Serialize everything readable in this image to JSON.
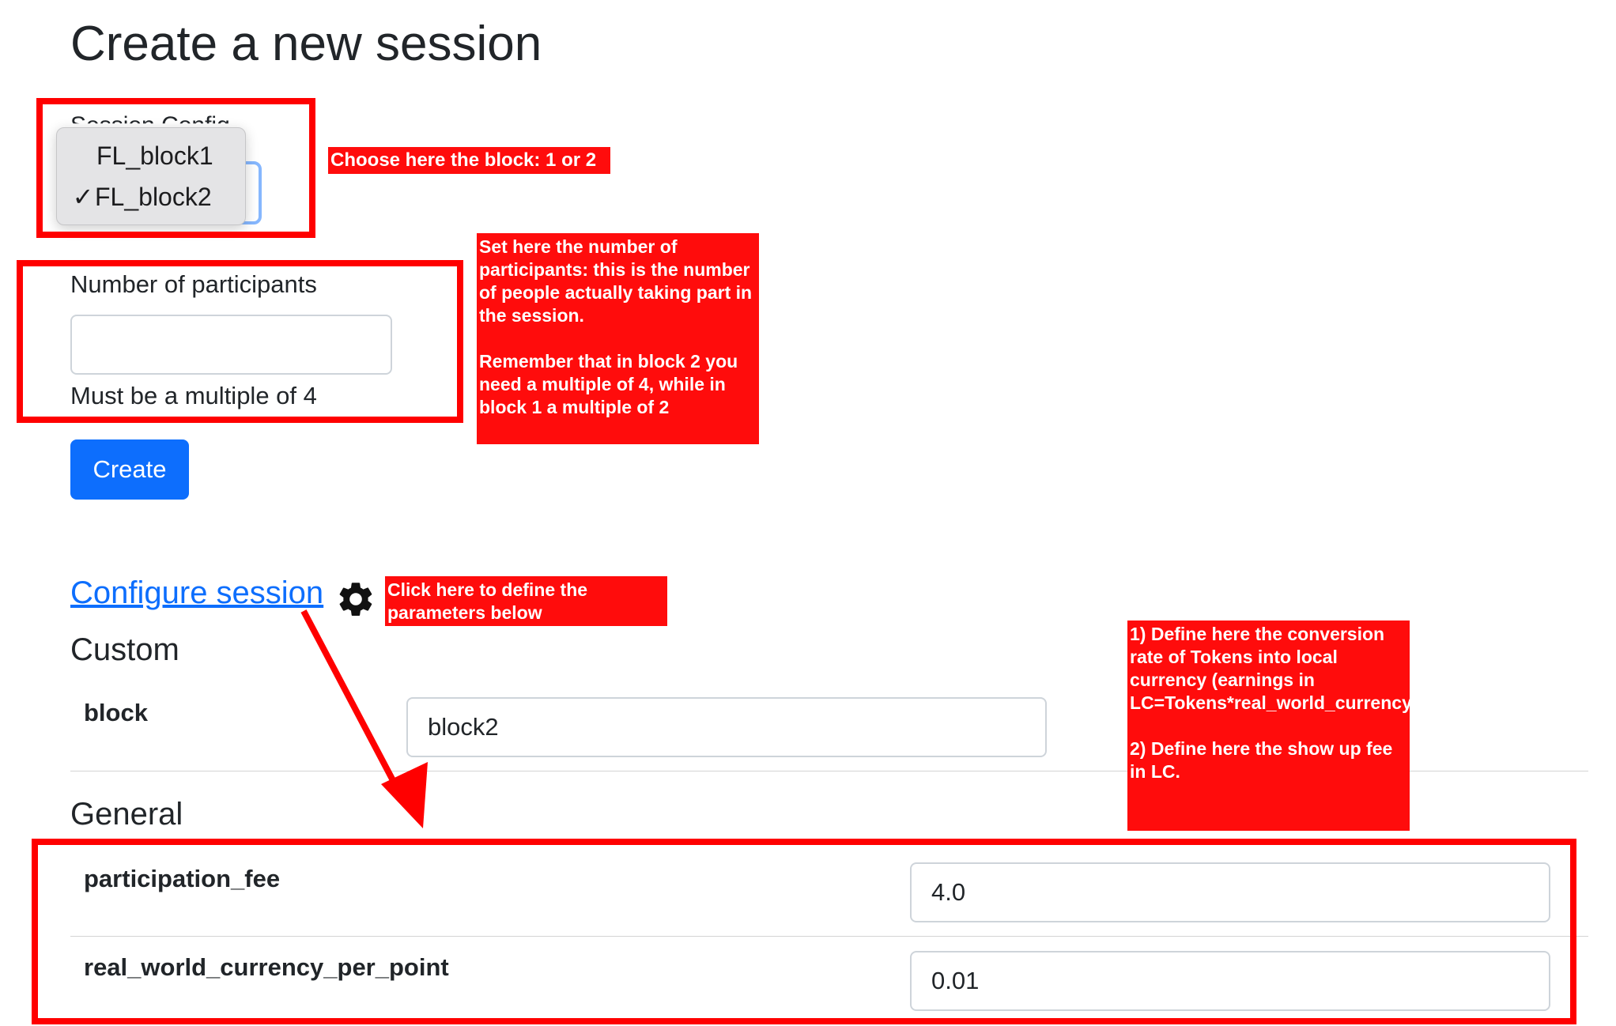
{
  "page": {
    "title": "Create a new session"
  },
  "session_config": {
    "label": "Session Config",
    "options": [
      {
        "label": "FL_block1",
        "selected": false
      },
      {
        "label": "FL_block2",
        "selected": true
      }
    ],
    "check_glyph": "✓"
  },
  "participants": {
    "label": "Number of participants",
    "value": "",
    "help": "Must be a multiple of 4"
  },
  "create_button": {
    "label": "Create"
  },
  "configure": {
    "link": "Configure session",
    "icon": "gear-icon"
  },
  "custom": {
    "heading": "Custom",
    "params": [
      {
        "name": "block",
        "value": "block2"
      }
    ]
  },
  "general": {
    "heading": "General",
    "params": [
      {
        "name": "participation_fee",
        "value": "4.0"
      },
      {
        "name": "real_world_currency_per_point",
        "value": "0.01"
      }
    ]
  },
  "annotations": {
    "choose_block": "Choose here the block: 1 or 2",
    "participants_note": "Set here the number of participants: this is the number of people actually taking part in the session.\n\nRemember that in block 2 you need a multiple of 4, while in block 1 a multiple of 2",
    "click_here": "Click here to define the parameters below",
    "conversion_note": "1) Define here the conversion rate of Tokens into local currency (earnings in LC=Tokens*real_world_currency_per_point).\n\n2) Define here the show up fee in LC.",
    "color": "#ff0000"
  }
}
